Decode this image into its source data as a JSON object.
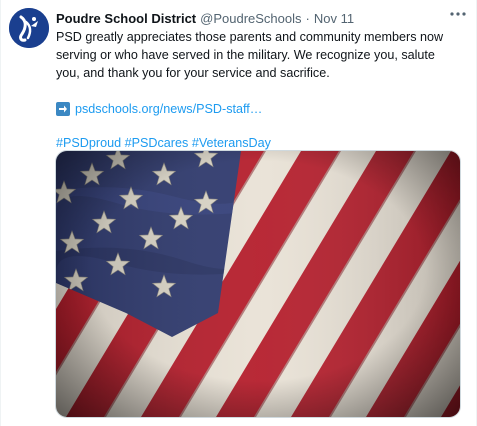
{
  "tweet": {
    "author_name": "Poudre School District",
    "handle": "@PoudreSchools",
    "separator": "·",
    "timestamp": "Nov 11",
    "body": "PSD greatly appreciates those parents and community members now serving or who have served in the military. We recognize you, salute you, and thank you for your service and sacrifice.",
    "link_text": "psdschools.org/news/PSD-staff…",
    "hashtags": [
      "#PSDproud",
      "#PSDcares",
      "#VeteransDay"
    ],
    "more_icon": "ellipsis-icon",
    "link_icon": "right-arrow-emoji-icon"
  },
  "media": {
    "description_icon": "american-flag-image",
    "colors": {
      "blue": "#2f3a6e",
      "red": "#b51e2c",
      "white": "#e9e2d6"
    }
  },
  "colors": {
    "link": "#1d9bf0",
    "secondary_text": "#536471",
    "avatar_bg": "#1a3f8f"
  }
}
